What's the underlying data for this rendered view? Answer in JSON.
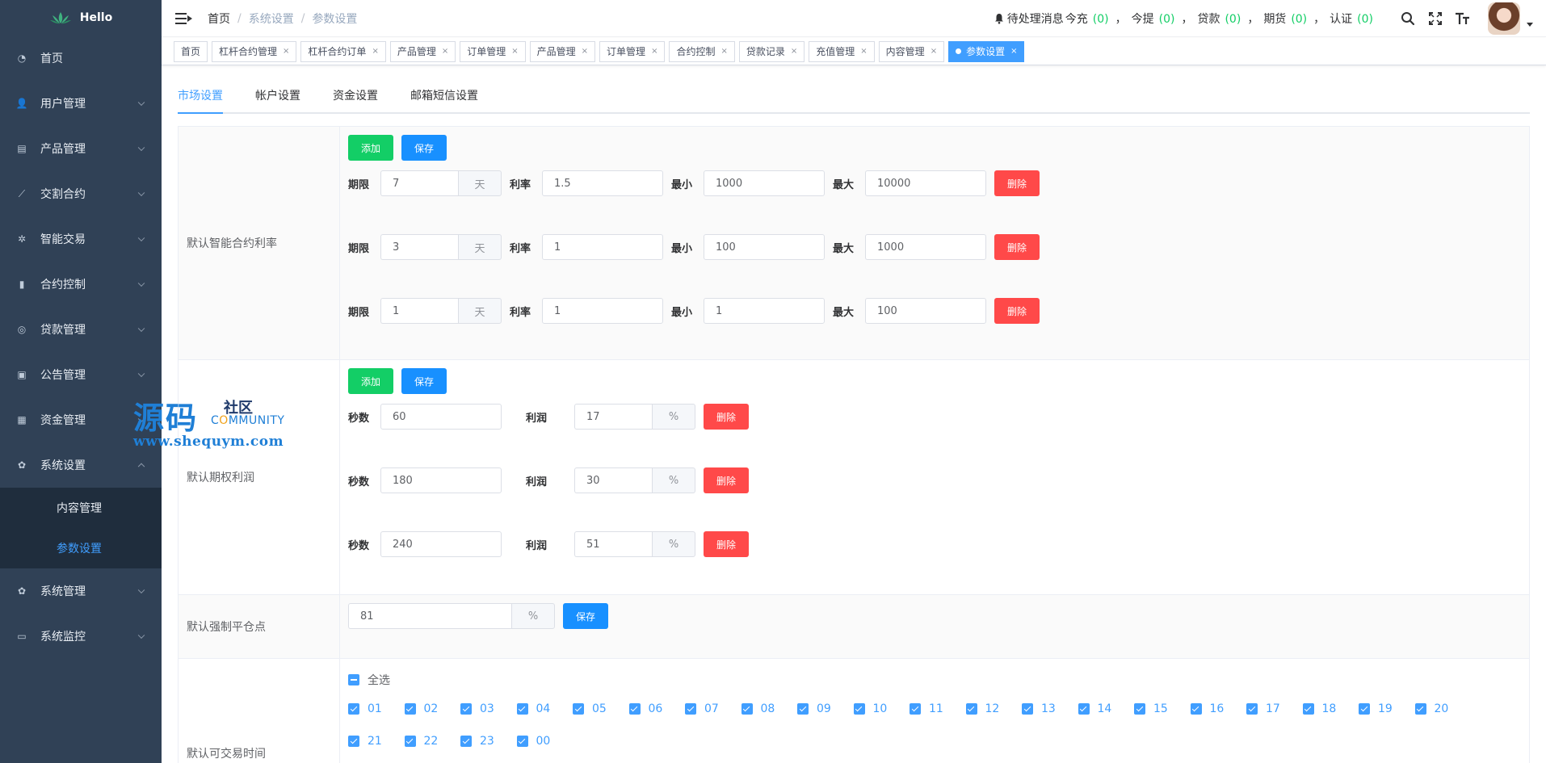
{
  "app": {
    "name": "Hello"
  },
  "sidebar": {
    "items": [
      {
        "label": "首页",
        "icon": "dashboard-icon",
        "has_chevron": false
      },
      {
        "label": "用户管理",
        "icon": "user-icon",
        "has_chevron": true
      },
      {
        "label": "产品管理",
        "icon": "document-icon",
        "has_chevron": true
      },
      {
        "label": "交割合约",
        "icon": "chart-line-icon",
        "has_chevron": true
      },
      {
        "label": "智能交易",
        "icon": "gear-small-icon",
        "has_chevron": true
      },
      {
        "label": "合约控制",
        "icon": "bar-chart-icon",
        "has_chevron": true
      },
      {
        "label": "贷款管理",
        "icon": "coins-icon",
        "has_chevron": true
      },
      {
        "label": "公告管理",
        "icon": "message-icon",
        "has_chevron": true
      },
      {
        "label": "资金管理",
        "icon": "money-icon",
        "has_chevron": true
      },
      {
        "label": "系统设置",
        "icon": "settings-icon",
        "has_chevron": true,
        "expanded": true
      },
      {
        "label": "系统管理",
        "icon": "settings-icon",
        "has_chevron": true
      },
      {
        "label": "系统监控",
        "icon": "monitor-icon",
        "has_chevron": true
      }
    ],
    "submenu": [
      {
        "label": "内容管理",
        "active": false
      },
      {
        "label": "参数设置",
        "active": true
      }
    ]
  },
  "header": {
    "breadcrumb": [
      "首页",
      "系统设置",
      "参数设置"
    ],
    "breadcrumb_sep": "/",
    "notice": {
      "prefix": "待处理消息",
      "items": [
        {
          "label": "今充",
          "count": "(0)"
        },
        {
          "label": "今提",
          "count": "(0)"
        },
        {
          "label": "贷款",
          "count": "(0)"
        },
        {
          "label": "期货",
          "count": "(0)"
        },
        {
          "label": "认证",
          "count": "(0)"
        }
      ],
      "separator": "，"
    }
  },
  "tags": [
    {
      "label": "首页",
      "closable": false,
      "active": false
    },
    {
      "label": "杠杆合约管理",
      "closable": true,
      "active": false
    },
    {
      "label": "杠杆合约订单",
      "closable": true,
      "active": false
    },
    {
      "label": "产品管理",
      "closable": true,
      "active": false
    },
    {
      "label": "订单管理",
      "closable": true,
      "active": false
    },
    {
      "label": "产品管理",
      "closable": true,
      "active": false
    },
    {
      "label": "订单管理",
      "closable": true,
      "active": false
    },
    {
      "label": "合约控制",
      "closable": true,
      "active": false
    },
    {
      "label": "贷款记录",
      "closable": true,
      "active": false
    },
    {
      "label": "充值管理",
      "closable": true,
      "active": false
    },
    {
      "label": "内容管理",
      "closable": true,
      "active": false
    },
    {
      "label": "参数设置",
      "closable": true,
      "active": true
    }
  ],
  "tabs": [
    {
      "label": "市场设置",
      "active": true
    },
    {
      "label": "帐户设置",
      "active": false
    },
    {
      "label": "资金设置",
      "active": false
    },
    {
      "label": "邮箱短信设置",
      "active": false
    }
  ],
  "buttons": {
    "add": "添加",
    "save": "保存",
    "delete": "删除"
  },
  "smart_contract": {
    "label": "默认智能合约利率",
    "field_labels": {
      "term": "期限",
      "unit": "天",
      "rate": "利率",
      "min": "最小",
      "max": "最大"
    },
    "rows": [
      {
        "term": "7",
        "rate": "1.5",
        "min": "1000",
        "max": "10000"
      },
      {
        "term": "3",
        "rate": "1",
        "min": "100",
        "max": "1000"
      },
      {
        "term": "1",
        "rate": "1",
        "min": "1",
        "max": "100"
      }
    ]
  },
  "option_profit": {
    "label": "默认期权利润",
    "field_labels": {
      "seconds": "秒数",
      "profit": "利润",
      "unit": "%"
    },
    "rows": [
      {
        "seconds": "60",
        "profit": "17"
      },
      {
        "seconds": "180",
        "profit": "30"
      },
      {
        "seconds": "240",
        "profit": "51"
      }
    ]
  },
  "liquidation": {
    "label": "默认强制平仓点",
    "value": "81",
    "unit": "%"
  },
  "trade_hours": {
    "label": "默认可交易时间",
    "select_all": "全选",
    "hours": [
      "01",
      "02",
      "03",
      "04",
      "05",
      "06",
      "07",
      "08",
      "09",
      "10",
      "11",
      "12",
      "13",
      "14",
      "15",
      "16",
      "17",
      "18",
      "19",
      "20",
      "21",
      "22",
      "23",
      "00"
    ]
  },
  "watermark": {
    "big": "源码",
    "small1": "社区",
    "small2_a": "C",
    "small2_b": "O",
    "small2_c": "MMUNITY",
    "url": "www.shequym.com"
  },
  "colors": {
    "sidebar_bg": "#304156",
    "submenu_bg": "#1f2d3d",
    "accent": "#409eff",
    "success": "#13ce66",
    "danger": "#ff4949"
  }
}
